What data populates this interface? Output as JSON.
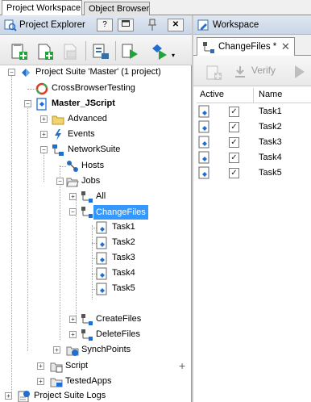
{
  "top_tabs": [
    "Project Workspace",
    "Object Browser"
  ],
  "explorer": {
    "title": "Project Explorer",
    "help_label": "?",
    "pin_label": "✦"
  },
  "tree": {
    "root": "Project Suite 'Master' (1 project)",
    "cross": "CrossBrowserTesting",
    "project": "Master_JScript",
    "advanced": "Advanced",
    "events": "Events",
    "network": "NetworkSuite",
    "hosts": "Hosts",
    "jobs": "Jobs",
    "all": "All",
    "changefiles": "ChangeFiles",
    "task1": "Task1",
    "task2": "Task2",
    "task3": "Task3",
    "task4": "Task4",
    "task5": "Task5",
    "createfiles": "CreateFiles",
    "deletefiles": "DeleteFiles",
    "synch": "SynchPoints",
    "script": "Script",
    "testedapps": "TestedApps",
    "logs": "Project Suite Logs",
    "plus": "+"
  },
  "workspace": {
    "title": "Workspace",
    "tab_label": "ChangeFiles *",
    "close": "✕",
    "verify": "Verify",
    "col_active": "Active",
    "col_name": "Name",
    "rows": [
      {
        "name": "Task1",
        "checked": "✓"
      },
      {
        "name": "Task2",
        "checked": "✓"
      },
      {
        "name": "Task3",
        "checked": "✓"
      },
      {
        "name": "Task4",
        "checked": "✓"
      },
      {
        "name": "Task5",
        "checked": "✓"
      }
    ]
  },
  "colors": {
    "selection": "#3399ff",
    "header_gradient_top": "#dfe7f1",
    "network_icon": "#1f6fd1",
    "add_green": "#22a33a"
  }
}
